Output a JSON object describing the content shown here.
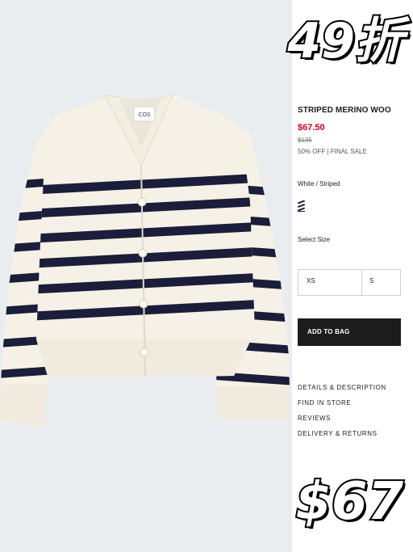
{
  "product": {
    "title": "STRIPED MERINO WOO",
    "price": "$67.50",
    "original_price": "$135",
    "sale_note": "50% OFF | FINAL SALE",
    "color_label": "White / Striped",
    "size_label": "Select Size",
    "sizes": [
      "XS",
      "S"
    ],
    "add_to_bag": "ADD TO BAG",
    "links": [
      "DETAILS & DESCRIPTION",
      "FIND IN STORE",
      "REVIEWS",
      "DELIVERY & RETURNS"
    ],
    "label_tag": "COS"
  },
  "overlay": {
    "discount": "49折",
    "price": "$67"
  },
  "colors": {
    "price_red": "#d0021b",
    "button": "#1c1c1c",
    "stripe": "#1b1e3a",
    "knit": "#f6f1e6",
    "background": "#e9edef"
  }
}
